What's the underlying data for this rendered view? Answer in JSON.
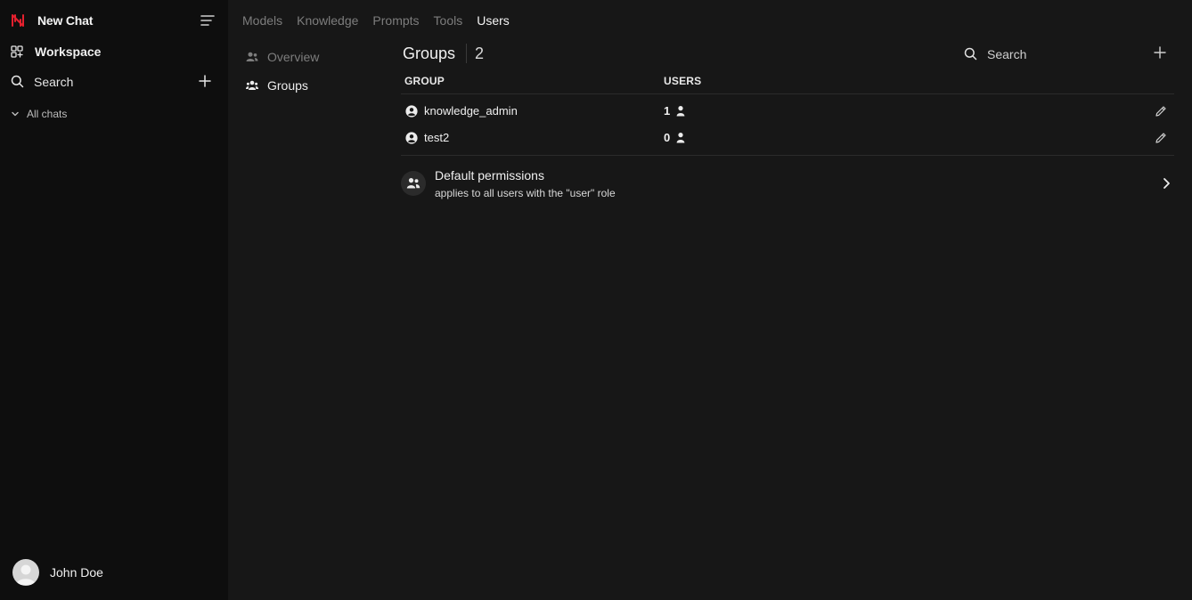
{
  "sidebar": {
    "new_chat_label": "New Chat",
    "workspace_label": "Workspace",
    "search_label": "Search",
    "all_chats_label": "All chats",
    "user_name": "John Doe",
    "logo_color": "#e5202e"
  },
  "topnav": {
    "tabs": [
      {
        "label": "Models"
      },
      {
        "label": "Knowledge"
      },
      {
        "label": "Prompts"
      },
      {
        "label": "Tools"
      },
      {
        "label": "Users"
      }
    ],
    "active": "Users"
  },
  "subnav": {
    "items": [
      {
        "label": "Overview",
        "icon": "users-icon"
      },
      {
        "label": "Groups",
        "icon": "user-group-icon"
      }
    ],
    "active": "Groups"
  },
  "groups": {
    "title": "Groups",
    "count": "2",
    "search_placeholder": "Search",
    "columns": {
      "group": "GROUP",
      "users": "USERS"
    },
    "rows": [
      {
        "name": "knowledge_admin",
        "users": "1"
      },
      {
        "name": "test2",
        "users": "0"
      }
    ],
    "default_permissions": {
      "title": "Default permissions",
      "subtitle": "applies to all users with the \"user\" role"
    }
  }
}
